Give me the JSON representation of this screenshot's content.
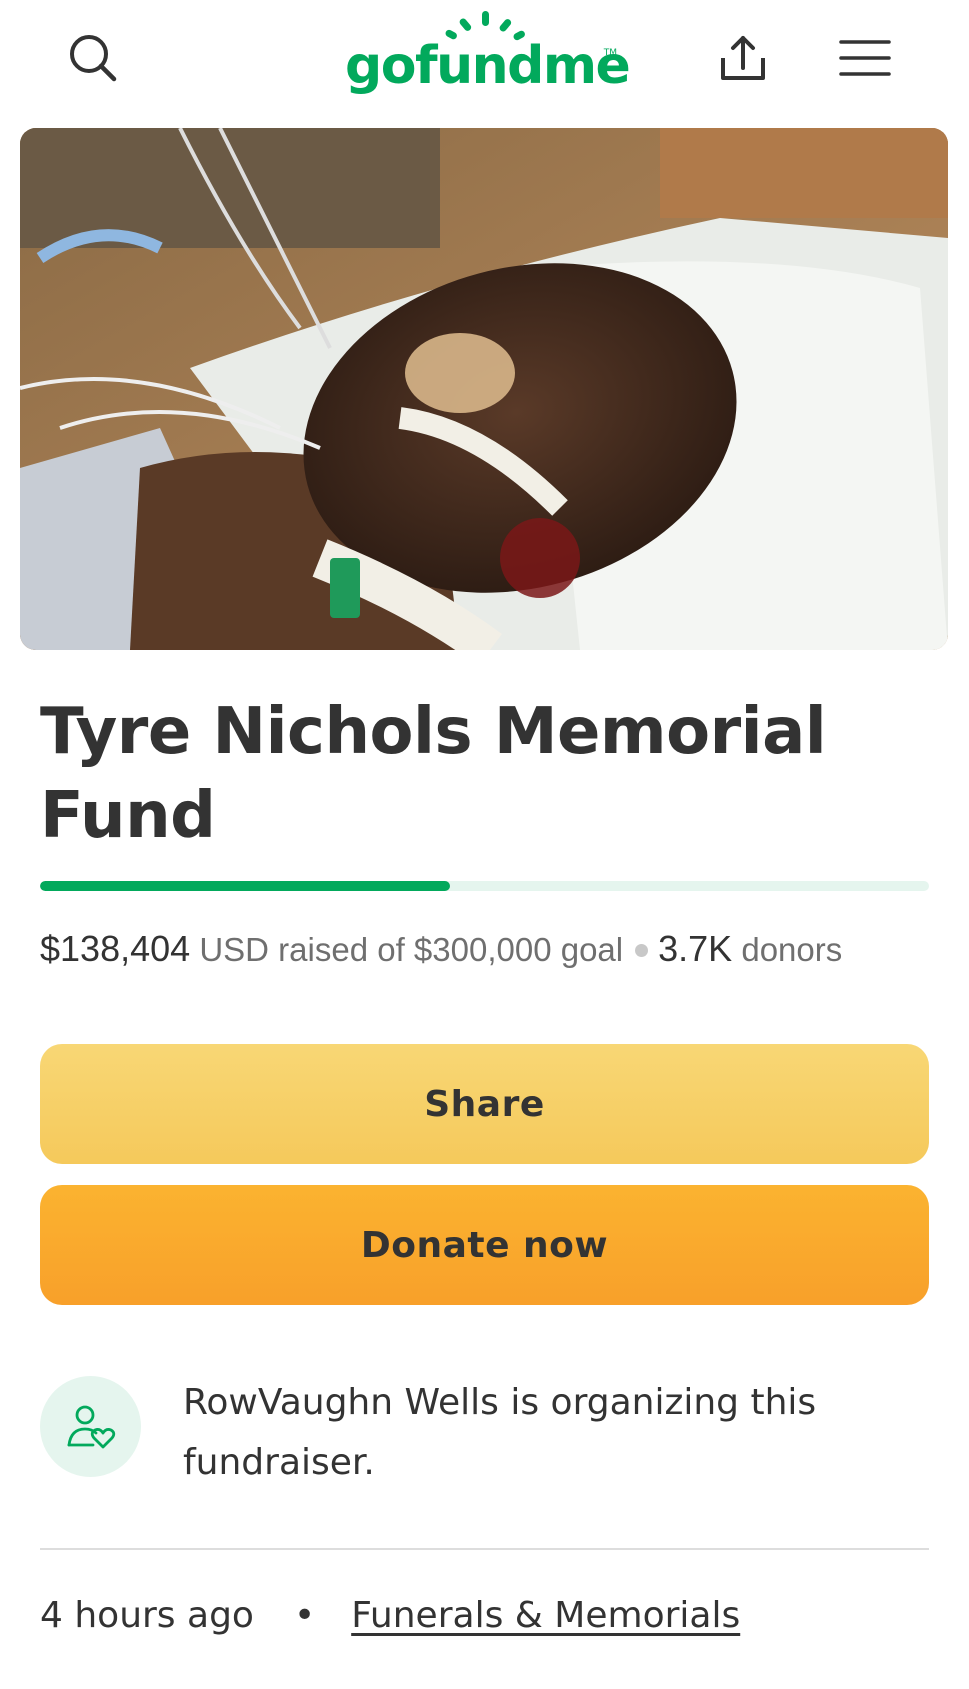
{
  "header": {
    "logo_text": "gofundme",
    "logo_tm": "TM",
    "search_icon": "search-icon",
    "share_icon": "share-upload-icon",
    "menu_icon": "hamburger-menu-icon",
    "brand_color": "#02a95c"
  },
  "campaign": {
    "title": "Tyre Nichols Memorial Fund",
    "progress_fraction": 0.4613,
    "raised_amount": "$138,404",
    "raised_suffix": "USD raised of $300,000 goal",
    "donor_count": "3.7K",
    "donor_label": "donors"
  },
  "actions": {
    "share_label": "Share",
    "donate_label": "Donate now",
    "share_color": "#f6cf68",
    "donate_color": "#f9a92d"
  },
  "organizer": {
    "icon": "person-heart-icon",
    "text": "RowVaughn Wells is organizing this fundraiser."
  },
  "meta": {
    "posted": "4 hours ago",
    "bullet": "•",
    "category": "Funerals & Memorials"
  }
}
